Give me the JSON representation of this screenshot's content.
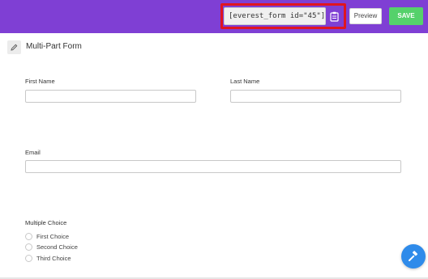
{
  "colors": {
    "topbar": "#7f3fd4",
    "highlight": "#e0151f",
    "save_button": "#55d16b",
    "fab": "#2f8bea"
  },
  "toolbar": {
    "shortcode": "[everest_form id=\"45\"]",
    "copy_icon": "clipboard-icon",
    "preview_label": "Preview",
    "save_label": "SAVE"
  },
  "form": {
    "title": "Multi-Part Form",
    "edit_icon": "pencil-icon",
    "fields": {
      "first_name": {
        "label": "First Name",
        "value": ""
      },
      "last_name": {
        "label": "Last Name",
        "value": ""
      },
      "email": {
        "label": "Email",
        "value": ""
      }
    },
    "multiple_choice": {
      "label": "Multiple Choice",
      "options": [
        "First Choice",
        "Second Choice",
        "Third Choice"
      ]
    }
  },
  "fab_icon": "hammer-icon"
}
